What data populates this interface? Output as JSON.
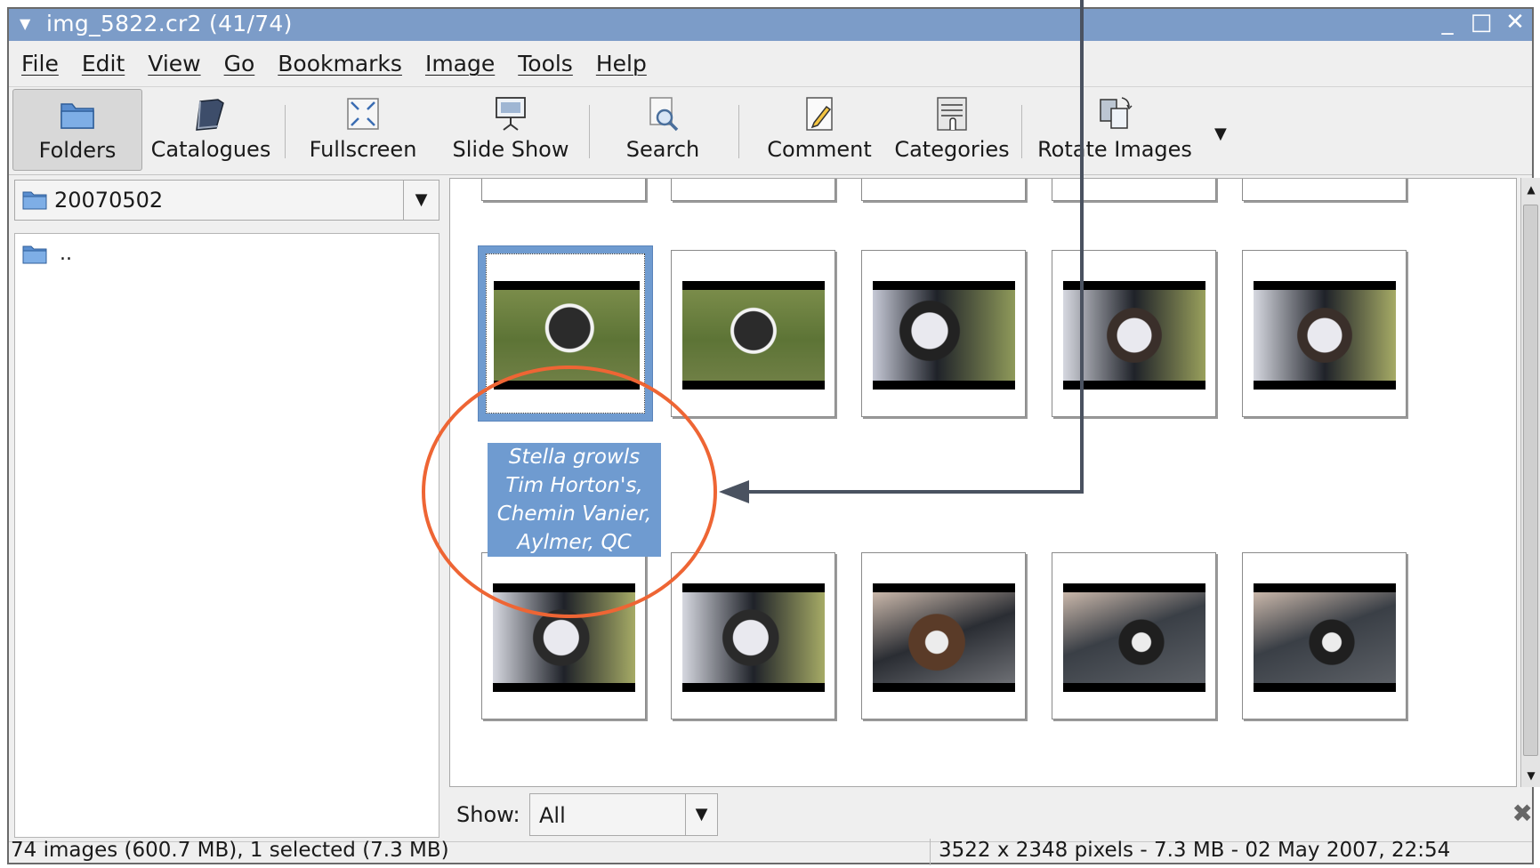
{
  "window": {
    "title": "img_5822.cr2  (41/74)",
    "controls": [
      "_",
      "□",
      "✕"
    ]
  },
  "menubar": [
    "File",
    "Edit",
    "View",
    "Go",
    "Bookmarks",
    "Image",
    "Tools",
    "Help"
  ],
  "toolbar": {
    "folders": "Folders",
    "catalogues": "Catalogues",
    "fullscreen": "Fullscreen",
    "slideshow": "Slide Show",
    "search": "Search",
    "comment": "Comment",
    "categories": "Categories",
    "rotate": "Rotate Images"
  },
  "sidebar": {
    "location": "20070502",
    "parent_entry": ".."
  },
  "gallery": {
    "selected_caption": [
      "Stella growls",
      "Tim Horton's,",
      "Chemin Vanier,",
      "Aylmer, QC"
    ]
  },
  "filter": {
    "label": "Show:",
    "value": "All"
  },
  "status": {
    "left": "74 images (600.7 MB), 1 selected (7.3 MB)",
    "right": "3522 x 2348 pixels - 7.3 MB - 02 May 2007, 22:54"
  },
  "colors": {
    "titlebar": "#7c9cc8",
    "selection": "#6f9bd0",
    "annotation_circle": "#ee6534",
    "annotation_arrow": "#4a5260"
  }
}
